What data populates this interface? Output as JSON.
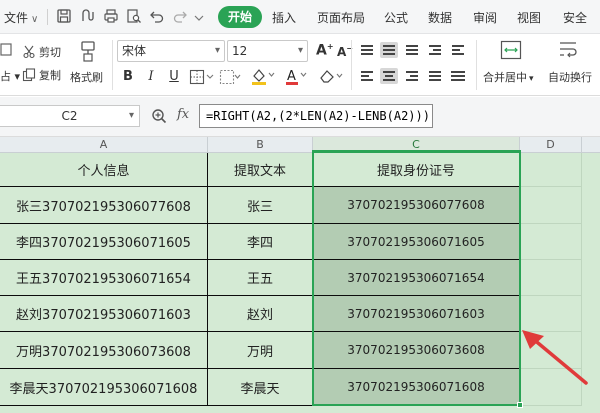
{
  "menubar": {
    "file_label": "文件",
    "tabs": [
      "开始",
      "插入",
      "页面布局",
      "公式",
      "数据",
      "审阅",
      "视图",
      "安全"
    ],
    "active_tab": "开始",
    "accent_color": "#2aa355"
  },
  "ribbon": {
    "cut_label": "剪切",
    "copy_label": "复制",
    "format_painter_label": "格式刷",
    "font_name": "宋体",
    "font_size": "12",
    "merge_center_label": "合并居中",
    "wrap_text_label": "自动换行",
    "bold": "B",
    "italic": "I",
    "underline": "U",
    "font_color_glyph": "A"
  },
  "formula_bar": {
    "name_box": "C2",
    "fx_label": "fx",
    "formula": "=RIGHT(A2,(2*LEN(A2)-LENB(A2)))"
  },
  "sheet": {
    "columns": [
      "A",
      "B",
      "C",
      "D"
    ],
    "headers": [
      "个人信息",
      "提取文本",
      "提取身份证号"
    ],
    "rows": [
      [
        "张三370702195306077608",
        "张三",
        "370702195306077608"
      ],
      [
        "李四370702195306071605",
        "李四",
        "370702195306071605"
      ],
      [
        "王五370702195306071654",
        "王五",
        "370702195306071654"
      ],
      [
        "赵刘370702195306071603",
        "赵刘",
        "370702195306071603"
      ],
      [
        "万明370702195306073608",
        "万明",
        "370702195306073608"
      ],
      [
        "李晨天370702195306071608",
        "李晨天",
        "370702195306071608"
      ]
    ],
    "selected_range_color": "#2aa355",
    "annotation_arrow_color": "#e03a3a"
  }
}
